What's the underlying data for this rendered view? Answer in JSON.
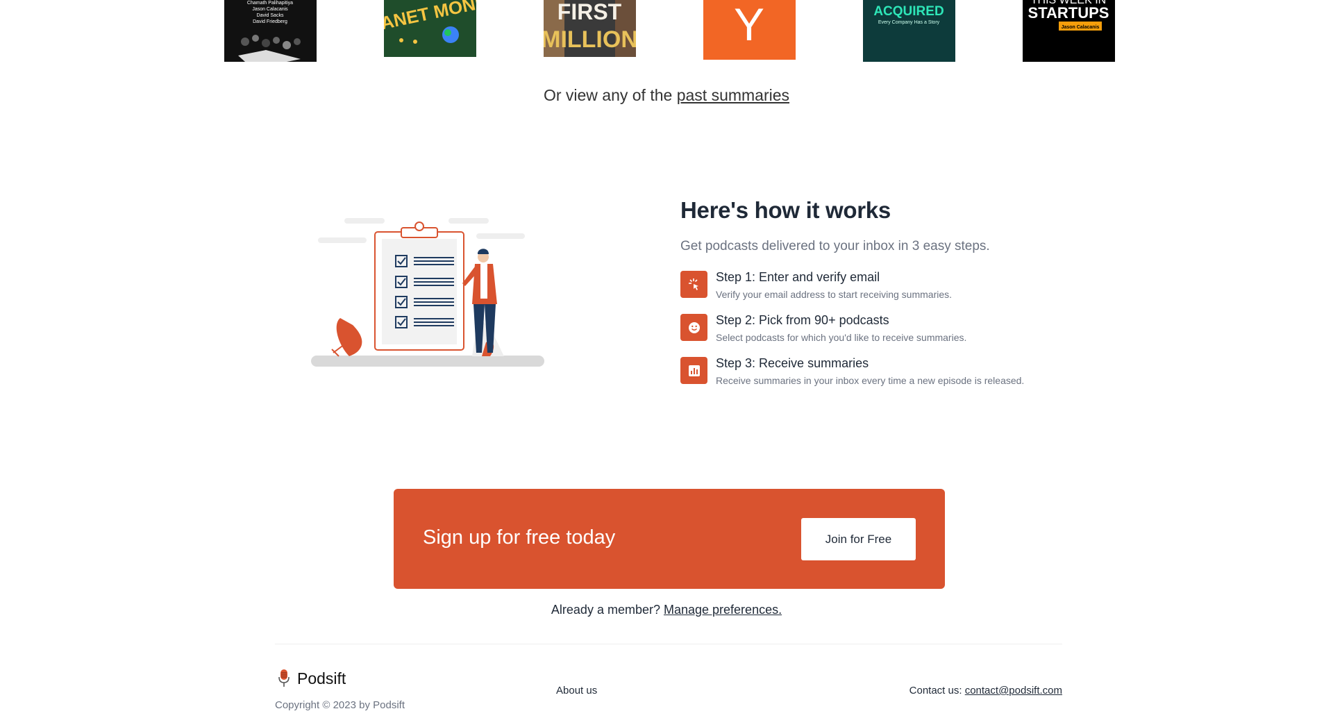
{
  "covers": [
    {
      "name": "all-in",
      "lines": [
        "Chamath Palihapitiya",
        "Jason Calacanis",
        "David Sacks",
        "David Friedberg"
      ]
    },
    {
      "name": "planet-money",
      "title": "PLANET MONEY"
    },
    {
      "name": "my-first-million",
      "title_top": "FIRST",
      "title_bottom": "MILLION"
    },
    {
      "name": "y-combinator",
      "title": "Y"
    },
    {
      "name": "acquired",
      "title": "ACQUIRED",
      "tagline": "Every Company Has a Story"
    },
    {
      "name": "this-week-in-startups",
      "title_top": "THIS WEEK IN",
      "title_bottom": "STARTUPS",
      "host": "Jason Calacanis"
    }
  ],
  "past": {
    "prefix": "Or view any of the ",
    "link": "past summaries"
  },
  "how": {
    "title": "Here's how it works",
    "subtitle": "Get podcasts delivered to your inbox in 3 easy steps.",
    "steps": [
      {
        "title": "Step 1: Enter and verify email",
        "desc": "Verify your email address to start receiving summaries.",
        "icon": "cursor-click-icon"
      },
      {
        "title": "Step 2: Pick from 90+ podcasts",
        "desc": "Select podcasts for which you'd like to receive summaries.",
        "icon": "smiley-icon"
      },
      {
        "title": "Step 3: Receive summaries",
        "desc": "Receive summaries in your inbox every time a new episode is released.",
        "icon": "bar-chart-icon"
      }
    ]
  },
  "banner": {
    "title": "Sign up for free today",
    "button": "Join for Free"
  },
  "member": {
    "prefix": "Already a member? ",
    "link": "Manage preferences."
  },
  "footer": {
    "brand": "Podsift",
    "copyright": "Copyright © 2023 by Podsift",
    "about": "About us",
    "contact_prefix": "Contact us: ",
    "contact_email": "contact@podsift.com"
  },
  "colors": {
    "accent": "#d9532f",
    "text": "#1f2937",
    "muted": "#6b7280"
  }
}
